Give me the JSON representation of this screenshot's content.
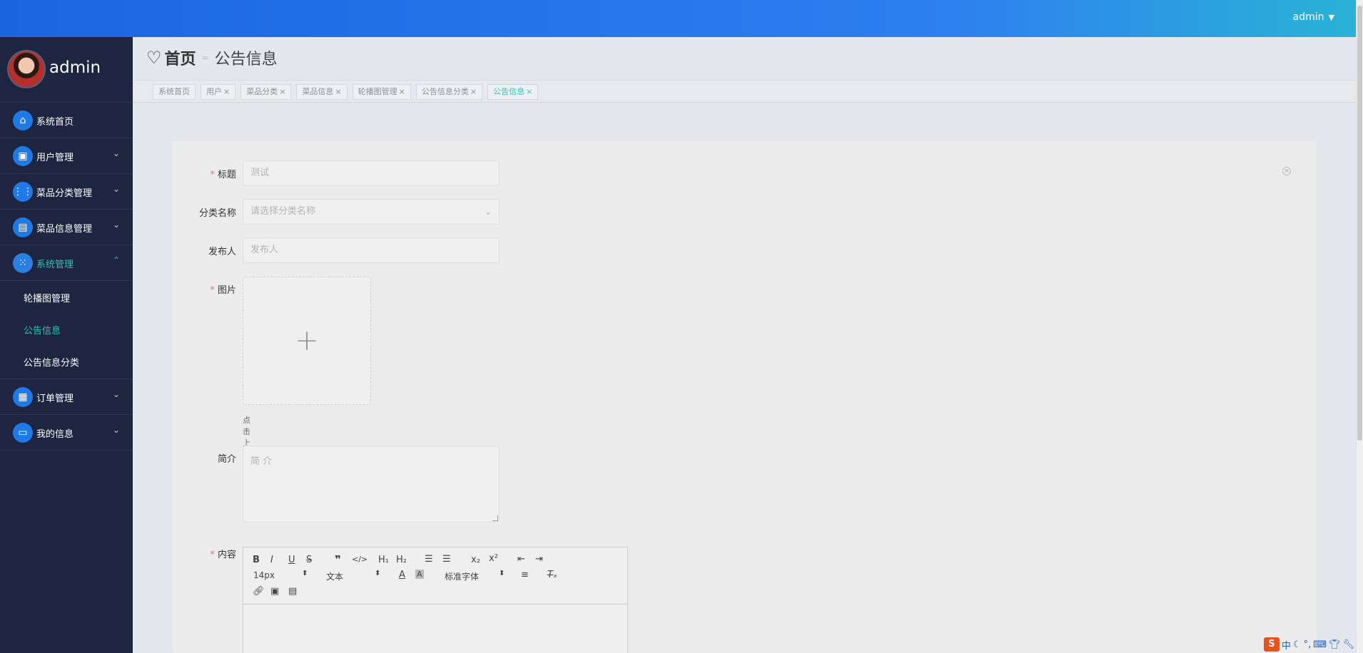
{
  "header": {
    "user": "admin"
  },
  "sidebar": {
    "profile_name": "admin",
    "items": [
      {
        "label": "系统首页",
        "icon": "home-icon"
      },
      {
        "label": "用户管理",
        "icon": "briefcase-icon"
      },
      {
        "label": "菜品分类管理",
        "icon": "grid-icon"
      },
      {
        "label": "菜品信息管理",
        "icon": "clipboard-icon"
      },
      {
        "label": "系统管理",
        "icon": "apps-icon"
      },
      {
        "label": "订单管理",
        "icon": "dashboard-icon"
      },
      {
        "label": "我的信息",
        "icon": "card-icon"
      }
    ],
    "system_sub": [
      {
        "label": "轮播图管理"
      },
      {
        "label": "公告信息"
      },
      {
        "label": "公告信息分类"
      }
    ]
  },
  "breadcrumb": {
    "home": "首页",
    "current": "公告信息"
  },
  "tags": [
    "系统首页",
    "用户",
    "菜品分类",
    "菜品信息",
    "轮播图管理",
    "公告信息分类",
    "公告信息"
  ],
  "form": {
    "title_label": "标题",
    "title_value": "测试",
    "category_label": "分类名称",
    "category_placeholder": "请选择分类名称",
    "publisher_label": "发布人",
    "publisher_placeholder": "发布人",
    "image_label": "图片",
    "upload_hint": "点击上传图片",
    "intro_label": "简介",
    "intro_placeholder": "简 介",
    "content_label": "内容"
  },
  "editor": {
    "font_size": "14px",
    "format": "文本",
    "font_family": "标准字体"
  },
  "ime": {
    "lang": "中"
  }
}
